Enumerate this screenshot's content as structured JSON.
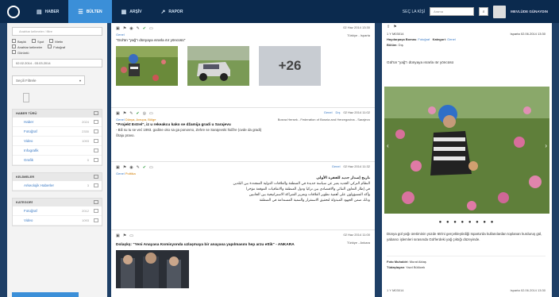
{
  "nav": {
    "items": [
      {
        "label": "HABER",
        "icon": "news-icon"
      },
      {
        "label": "BÜLTEN",
        "icon": "bulletin-icon"
      },
      {
        "label": "ARŞİV",
        "icon": "archive-icon"
      },
      {
        "label": "RAPOR",
        "icon": "report-icon"
      }
    ],
    "active_index": 1,
    "language": "SEÇ LA KİŞİ",
    "search_placeholder": "Arama",
    "user": "MEVLÜDE GÜNAYDIN"
  },
  "sidebar": {
    "search_placeholder": "Anahtar kelimeler / filtre",
    "checkboxes": [
      "Başlık",
      "Spot",
      "Metin",
      "Anahtar kelimeler",
      "Fotoğraf",
      "Görüntü"
    ],
    "date_range": "02.02.2014 - 03.03.2014",
    "filter_placeholder": "Seçili Filtrele",
    "sections": [
      {
        "title": "HABER TÜRÜ",
        "rows": [
          {
            "label": "Haber",
            "count": "2024"
          },
          {
            "label": "Fotoğraf",
            "count": "2330"
          },
          {
            "label": "Video",
            "count": "1093"
          },
          {
            "label": "Infografik",
            "count": ""
          },
          {
            "label": "Grafik",
            "count": "0"
          }
        ]
      },
      {
        "title": "KELİMELER",
        "rows": [
          {
            "label": "Arkeolojik Haberler",
            "count": "3"
          }
        ]
      },
      {
        "title": "KATEGORİ",
        "rows": [
          {
            "label": "Fotoğraf",
            "count": "2012"
          },
          {
            "label": "Video",
            "count": "1093"
          }
        ]
      }
    ]
  },
  "feed": [
    {
      "category": "Genel",
      "date": "02 Haz 2014 13:30",
      "location": "Türkiye - Isparta",
      "title": "\"Gül'ün \"yağ\"ı dünyaya ısrarla ıtır yöncüsü\"",
      "photos_more": "+26"
    },
    {
      "category": "Genel",
      "category_extra": "Dünya, Avrupa, Bölge",
      "meta_tag": "Genel",
      "meta_kind": "Dış",
      "date": "02 Haz 2014 11:02",
      "location": "Bosna Hersek - Federation of Bosnia and Herzegovina - Sarajevo",
      "headline": "\"Projekt Estrel\", iz u rekeakcu kako se džamija gradi u Sarajevu",
      "body1": "- Bili su tu se već 1993. godine oko sa ga ponovno, Zehre se Sarajevski hidžre (ovde da gradi)",
      "body2": "čitaju pravo."
    },
    {
      "category": "Genel",
      "category_extra": "Politika",
      "meta_tag": "Genel",
      "date": "02 Haz 2014 11:32",
      "arabic": [
        "تاريخ إصدار جديد للفقرة الأولى",
        "النظام التركي الجديد يعبر عن سياسة جديدة في المنطقة والعلاقات الدولية المتجددة بين البلدين",
        "في إطار التعاون الثنائي والاقتصادي بين تركيا ودول المنطقة والاتفاقيات الموقعة مؤخرا",
        "وأكد المسؤولون على أهمية تطوير العلاقات وتعزيز الشراكة الاستراتيجية بين الجانبين",
        "وذلك ضمن الجهود المبذولة لتحقيق الاستقرار والتنمية المستدامة في المنطقة"
      ]
    },
    {
      "category": "",
      "date": "02 Haz 2014 11:00",
      "location": "Türkiye - Ankara",
      "headline": "Dolaşkş: \"Yeni Anayasa Komisyonda uzlaşmaya bir anayasa yapılmasını hep arzu ettik\" - ANKARA"
    }
  ],
  "detail": {
    "id_label": "1 Y M03014",
    "date_label": "Isparta 02.06.2014 13:30",
    "company_label": "Haydarpaşa Bomas",
    "company_value": "Fotoğraf",
    "category_label": "Kategori",
    "category_value": "Genel",
    "lang_label": "Bölüm",
    "lang_value": "Dış",
    "title": "Gül'ün \"yağ\"ı dünyaya ısrarla ıtır yöncüsü",
    "caption": "Dünya gül yağı üretiminin yüzde 65'ini gerçekleştirdiği Isparta'da kullanılardan toplanan kurduruş gül, yabancı işlemleri sırasında Gül'lerdeki yağ çıktığı düzeyinde.",
    "credit_label": "Foto Muhabiri",
    "credit_value": "Murat Aktaş",
    "translator_label": "Tüdaşlayan",
    "translator_value": "Yazıl Bülücek",
    "footer_left": "1 Y M03014",
    "footer_right": "Isparta 02.06.2014 13:30"
  }
}
